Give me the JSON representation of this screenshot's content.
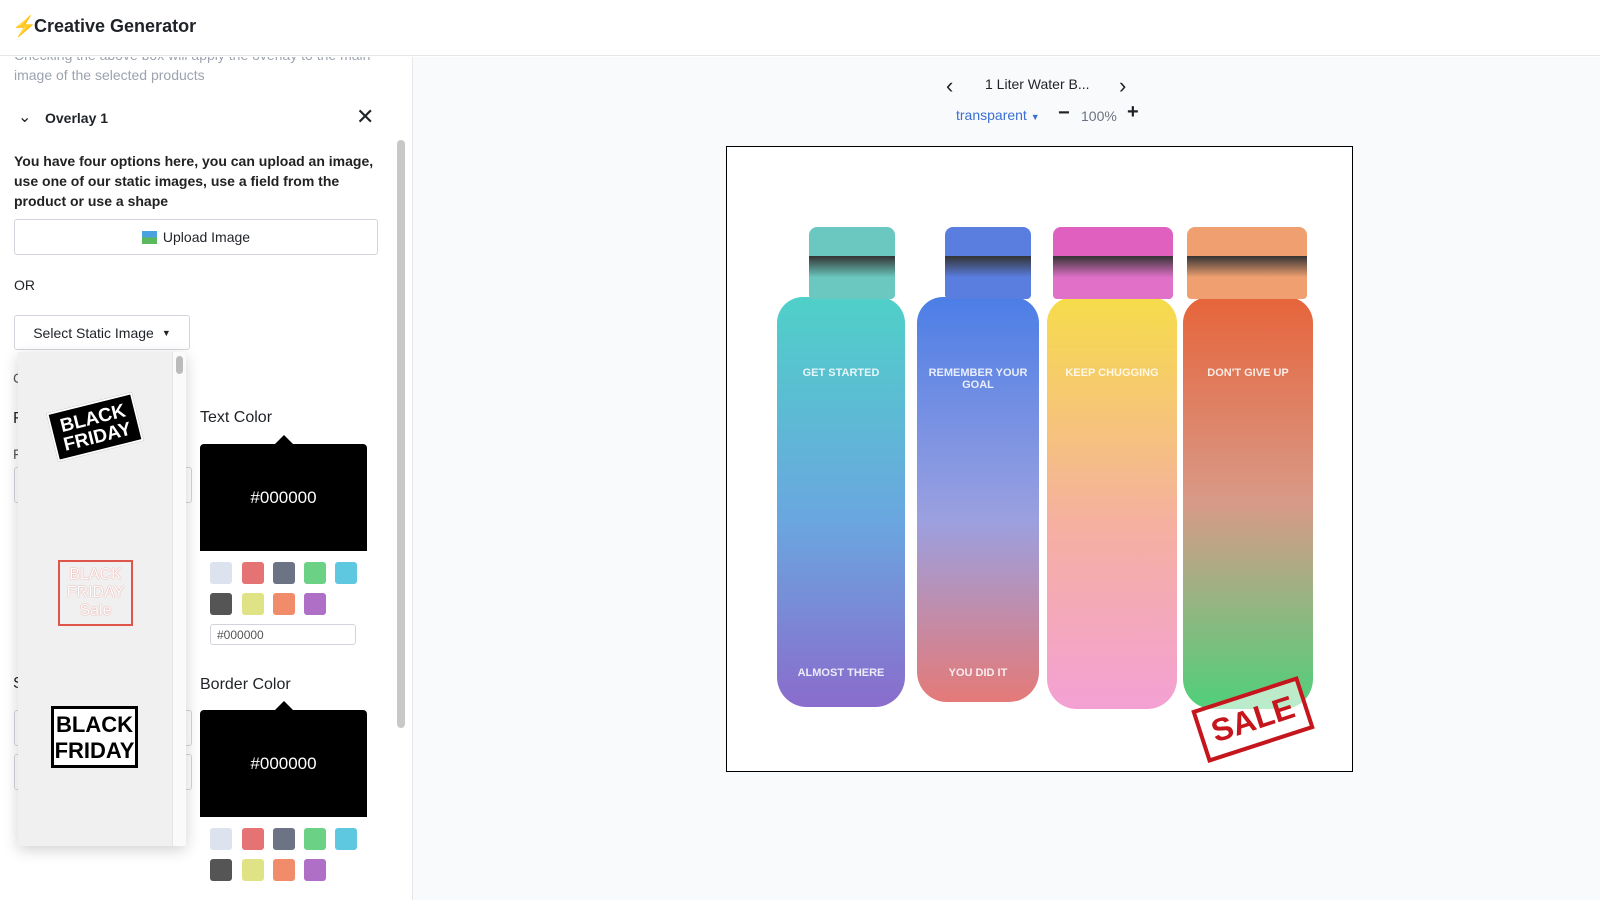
{
  "header": {
    "title": "Creative Generator",
    "icon": "lightning-bolt-icon"
  },
  "left": {
    "hint_partial": "Checking the above box will apply the overlay to the main",
    "hint": "image of the selected products",
    "overlay_title": "Overlay 1",
    "description": "You have four options here, you can upload an image, use one of our static images, use a field from the product or use a shape",
    "upload_label": "Upload Image",
    "or_label": "OR",
    "static_select_label": "Select Static Image",
    "hidden_letters": [
      "C",
      "F",
      "F",
      "S"
    ],
    "static_images": [
      "BLACK FRIDAY",
      "BLACK FRIDAY Sale",
      "BLACK FRIDAY"
    ],
    "text_color": {
      "label": "Text Color",
      "value": "#000000",
      "input": "#000000"
    },
    "border_color": {
      "label": "Border Color",
      "value": "#000000"
    },
    "swatches": [
      "#dce3ee",
      "#e57373",
      "#6b7385",
      "#6bd185",
      "#5ec8e0",
      "#555555",
      "#dfe385",
      "#f08c6a",
      "#b06fc6"
    ]
  },
  "preview": {
    "product_name": "1 Liter Water B...",
    "background": "transparent",
    "zoom": "100%",
    "sale_stamp": "SALE",
    "bottle_labels": [
      "GET STARTED",
      "REMEMBER YOUR GOAL",
      "KEEP CHUGGING",
      "DON'T GIVE UP",
      "ALMOST THERE",
      "YOU DID IT"
    ]
  }
}
